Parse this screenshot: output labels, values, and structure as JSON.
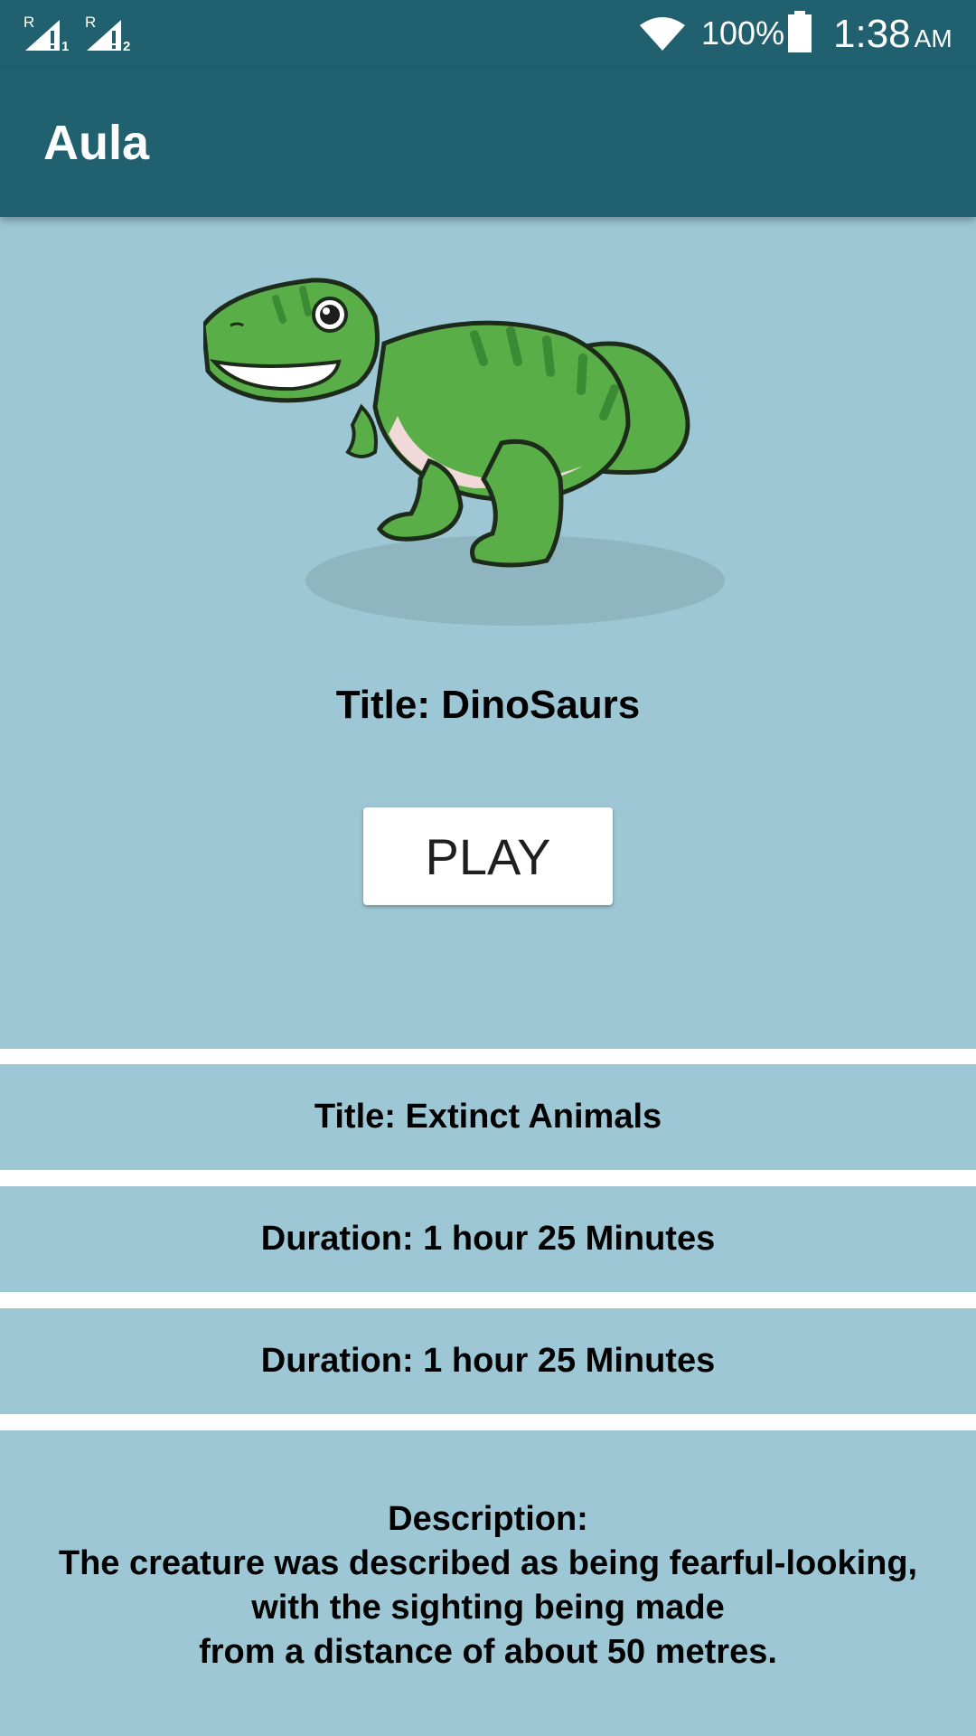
{
  "status_bar": {
    "sim1_label": "R",
    "sim1_sub": "1",
    "sim2_label": "R",
    "sim2_sub": "2",
    "battery_percent": "100%",
    "time": "1:38",
    "ampm": "AM",
    "icons": [
      "signal-icon",
      "signal-icon",
      "wifi-icon",
      "battery-icon"
    ]
  },
  "app_bar": {
    "title": "Aula"
  },
  "hero": {
    "image": "dinosaur-illustration",
    "title": "Title: DinoSaurs",
    "play_label": "PLAY"
  },
  "rows": [
    {
      "text": "Title: Extinct Animals"
    },
    {
      "text": "Duration: 1 hour 25 Minutes"
    },
    {
      "text": "Duration: 1 hour 25 Minutes"
    }
  ],
  "description": {
    "heading": "Description:",
    "lines": [
      "The creature was described as being fearful-looking,",
      "with the sighting being made",
      "from a distance of about 50 metres."
    ]
  },
  "colors": {
    "app_bar": "#21606f",
    "content_bg": "#9dc7d4",
    "separator": "#ffffff",
    "dino_green": "#5aae48"
  }
}
